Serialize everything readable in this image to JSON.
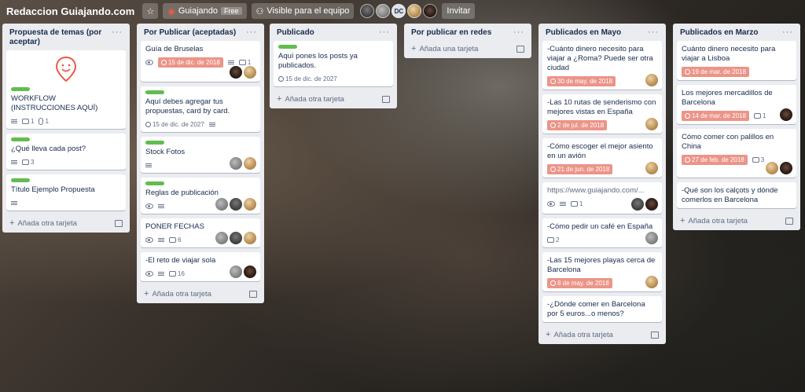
{
  "topbar": {
    "board_title": "Redaccion Guiajando.com",
    "team_name": "Guiajando",
    "free_badge": "Free",
    "visibility": "Visible para el equipo",
    "member_initials": "DC",
    "invite": "Invitar"
  },
  "add_card_label": "Añada otra tarjeta",
  "add_first_card_label": "Añada una tarjeta",
  "lists": [
    {
      "title": "Propuesta de temas (por aceptar)",
      "cards": [
        {
          "title": "WORKFLOW (INSTRUCCIONES AQUÍ)",
          "comments": "1",
          "attachments": "1"
        },
        {
          "title": "¿Qué lleva cada post?",
          "comments": "3"
        },
        {
          "title": "Título Ejemplo Propuesta"
        }
      ]
    },
    {
      "title": "Por Publicar (aceptadas)",
      "cards": [
        {
          "title": "Guía de Bruselas",
          "due": "15 de dic. de 2018",
          "comments": "1"
        },
        {
          "title": "Aquí debes agregar tus propuestas, card by card.",
          "due": "15 de dic. de 2027"
        },
        {
          "title": "Stock Fotos"
        },
        {
          "title": "Reglas de publicación"
        },
        {
          "title": "PONER FECHAS",
          "comments": "6"
        },
        {
          "title": "-El reto de viajar sola",
          "comments": "16"
        }
      ]
    },
    {
      "title": "Publicado",
      "cards": [
        {
          "title": "Aquí pones los posts ya publicados.",
          "due": "15 de dic. de 2027"
        }
      ]
    },
    {
      "title": "Por publicar en redes",
      "cards": []
    },
    {
      "title": "Publicados en Mayo",
      "cards": [
        {
          "title": "-Cuánto dinero necesito para viajar a ¿Roma? Puede ser otra ciudad",
          "due": "30 de may. de 2018"
        },
        {
          "title": "-Las 10 rutas de senderismo con mejores vistas en España",
          "due": "2 de jul. de 2018"
        },
        {
          "title": "-Cómo escoger el mejor asiento en un avión",
          "due": "21 de jun. de 2018"
        },
        {
          "title": "https://www.guiajando.com/...",
          "comments": "1"
        },
        {
          "title": "-Cómo pedir un café en España",
          "comments": "2"
        },
        {
          "title": "-Las 15 mejores playas cerca de Barcelona",
          "due": "8 de may. de 2018"
        },
        {
          "title": "-¿Dónde comer en Barcelona por 5 euros...o menos?"
        }
      ]
    },
    {
      "title": "Publicados en Marzo",
      "cards": [
        {
          "title": "Cuánto dinero necesito para viajar a Lisboa",
          "due": "19 de mar. de 2018"
        },
        {
          "title": "Los mejores mercadillos de Barcelona",
          "due": "14 de mar. de 2018",
          "comments": "1"
        },
        {
          "title": "Cómo comer con palillos en China",
          "due": "27 de feb. de 2018",
          "comments": "3"
        },
        {
          "title": "-Qué son los calçots y dónde comerlos en Barcelona"
        }
      ]
    }
  ],
  "colors": {
    "label_green": "#61bd4f",
    "due_overdue": "#ec9488",
    "list_bg": "#ebecf0",
    "logo_red": "#eb5a46"
  }
}
